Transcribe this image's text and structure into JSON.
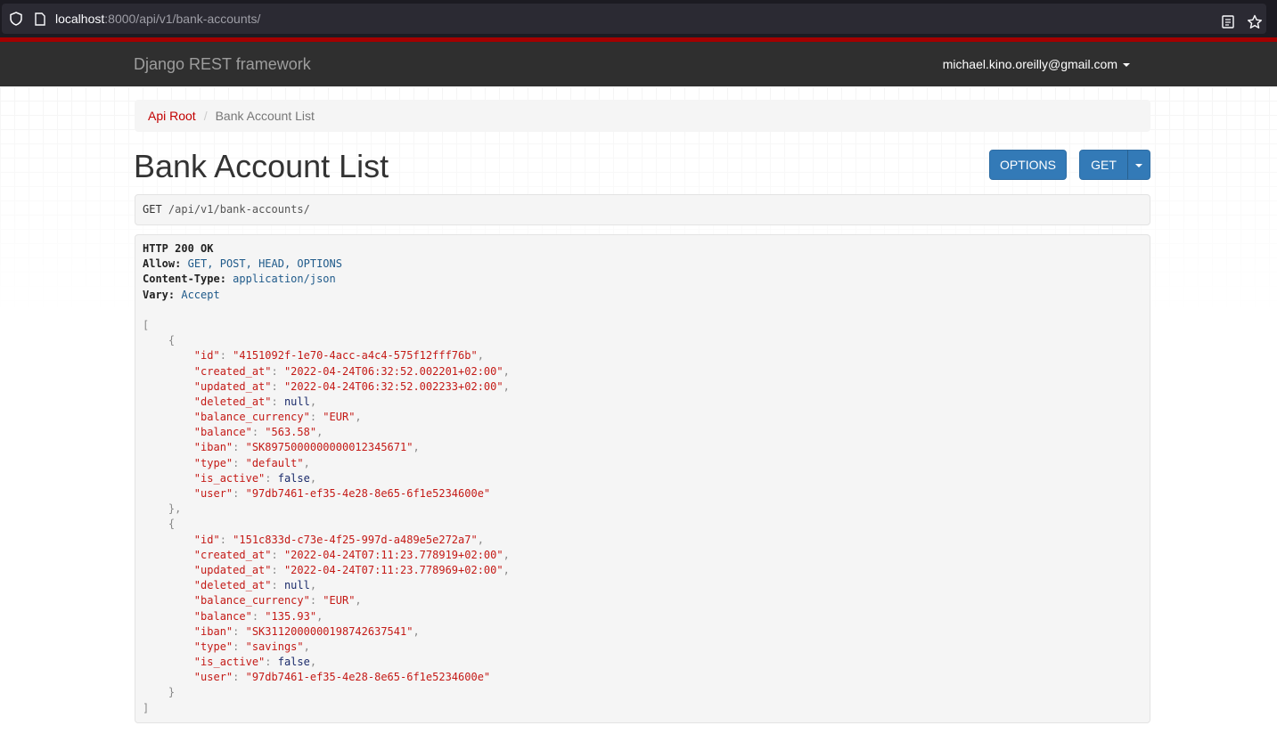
{
  "browser": {
    "url_host": "localhost",
    "url_rest": ":8000/api/v1/bank-accounts/"
  },
  "navbar": {
    "brand": "Django REST framework",
    "user_email": "michael.kino.oreilly@gmail.com"
  },
  "breadcrumb": {
    "root": "Api Root",
    "current": "Bank Account List"
  },
  "page": {
    "title": "Bank Account List",
    "options_label": "OPTIONS",
    "get_label": "GET"
  },
  "request": {
    "method": "GET",
    "path": "/api/v1/bank-accounts/"
  },
  "response": {
    "status": "HTTP 200 OK",
    "headers": [
      {
        "name": "Allow:",
        "value": "GET, POST, HEAD, OPTIONS"
      },
      {
        "name": "Content-Type:",
        "value": "application/json"
      },
      {
        "name": "Vary:",
        "value": "Accept"
      }
    ],
    "accounts": [
      {
        "id": "\"4151092f-1e70-4acc-a4c4-575f12fff76b\"",
        "created_at": "\"2022-04-24T06:32:52.002201+02:00\"",
        "updated_at": "\"2022-04-24T06:32:52.002233+02:00\"",
        "deleted_at": "null",
        "balance_currency": "\"EUR\"",
        "balance": "\"563.58\"",
        "iban": "\"SK8975000000000012345671\"",
        "type": "\"default\"",
        "is_active": "false",
        "user": "\"97db7461-ef35-4e28-8e65-6f1e5234600e\""
      },
      {
        "id": "\"151c833d-c73e-4f25-997d-a489e5e272a7\"",
        "created_at": "\"2022-04-24T07:11:23.778919+02:00\"",
        "updated_at": "\"2022-04-24T07:11:23.778969+02:00\"",
        "deleted_at": "null",
        "balance_currency": "\"EUR\"",
        "balance": "\"135.93\"",
        "iban": "\"SK3112000000198742637541\"",
        "type": "\"savings\"",
        "is_active": "false",
        "user": "\"97db7461-ef35-4e28-8e65-6f1e5234600e\""
      }
    ]
  }
}
